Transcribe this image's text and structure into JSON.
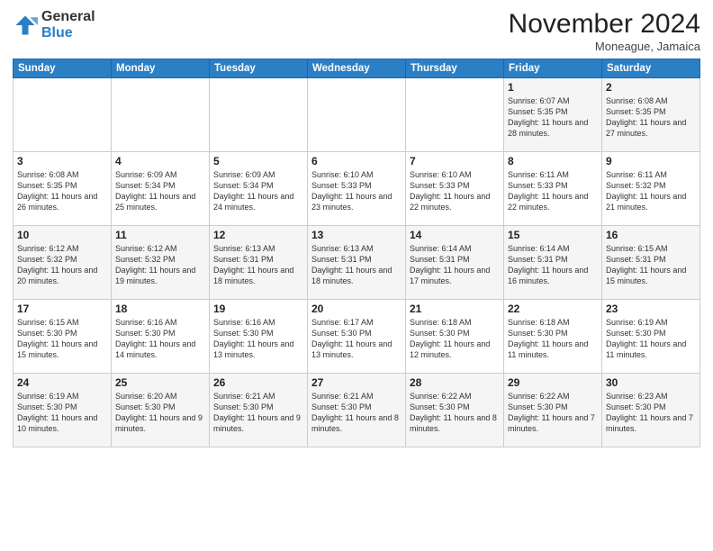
{
  "logo": {
    "general": "General",
    "blue": "Blue"
  },
  "header": {
    "month": "November 2024",
    "location": "Moneague, Jamaica"
  },
  "days_of_week": [
    "Sunday",
    "Monday",
    "Tuesday",
    "Wednesday",
    "Thursday",
    "Friday",
    "Saturday"
  ],
  "weeks": [
    [
      {
        "day": "",
        "sunrise": "",
        "sunset": "",
        "daylight": ""
      },
      {
        "day": "",
        "sunrise": "",
        "sunset": "",
        "daylight": ""
      },
      {
        "day": "",
        "sunrise": "",
        "sunset": "",
        "daylight": ""
      },
      {
        "day": "",
        "sunrise": "",
        "sunset": "",
        "daylight": ""
      },
      {
        "day": "",
        "sunrise": "",
        "sunset": "",
        "daylight": ""
      },
      {
        "day": "1",
        "sunrise": "Sunrise: 6:07 AM",
        "sunset": "Sunset: 5:35 PM",
        "daylight": "Daylight: 11 hours and 28 minutes."
      },
      {
        "day": "2",
        "sunrise": "Sunrise: 6:08 AM",
        "sunset": "Sunset: 5:35 PM",
        "daylight": "Daylight: 11 hours and 27 minutes."
      }
    ],
    [
      {
        "day": "3",
        "sunrise": "Sunrise: 6:08 AM",
        "sunset": "Sunset: 5:35 PM",
        "daylight": "Daylight: 11 hours and 26 minutes."
      },
      {
        "day": "4",
        "sunrise": "Sunrise: 6:09 AM",
        "sunset": "Sunset: 5:34 PM",
        "daylight": "Daylight: 11 hours and 25 minutes."
      },
      {
        "day": "5",
        "sunrise": "Sunrise: 6:09 AM",
        "sunset": "Sunset: 5:34 PM",
        "daylight": "Daylight: 11 hours and 24 minutes."
      },
      {
        "day": "6",
        "sunrise": "Sunrise: 6:10 AM",
        "sunset": "Sunset: 5:33 PM",
        "daylight": "Daylight: 11 hours and 23 minutes."
      },
      {
        "day": "7",
        "sunrise": "Sunrise: 6:10 AM",
        "sunset": "Sunset: 5:33 PM",
        "daylight": "Daylight: 11 hours and 22 minutes."
      },
      {
        "day": "8",
        "sunrise": "Sunrise: 6:11 AM",
        "sunset": "Sunset: 5:33 PM",
        "daylight": "Daylight: 11 hours and 22 minutes."
      },
      {
        "day": "9",
        "sunrise": "Sunrise: 6:11 AM",
        "sunset": "Sunset: 5:32 PM",
        "daylight": "Daylight: 11 hours and 21 minutes."
      }
    ],
    [
      {
        "day": "10",
        "sunrise": "Sunrise: 6:12 AM",
        "sunset": "Sunset: 5:32 PM",
        "daylight": "Daylight: 11 hours and 20 minutes."
      },
      {
        "day": "11",
        "sunrise": "Sunrise: 6:12 AM",
        "sunset": "Sunset: 5:32 PM",
        "daylight": "Daylight: 11 hours and 19 minutes."
      },
      {
        "day": "12",
        "sunrise": "Sunrise: 6:13 AM",
        "sunset": "Sunset: 5:31 PM",
        "daylight": "Daylight: 11 hours and 18 minutes."
      },
      {
        "day": "13",
        "sunrise": "Sunrise: 6:13 AM",
        "sunset": "Sunset: 5:31 PM",
        "daylight": "Daylight: 11 hours and 18 minutes."
      },
      {
        "day": "14",
        "sunrise": "Sunrise: 6:14 AM",
        "sunset": "Sunset: 5:31 PM",
        "daylight": "Daylight: 11 hours and 17 minutes."
      },
      {
        "day": "15",
        "sunrise": "Sunrise: 6:14 AM",
        "sunset": "Sunset: 5:31 PM",
        "daylight": "Daylight: 11 hours and 16 minutes."
      },
      {
        "day": "16",
        "sunrise": "Sunrise: 6:15 AM",
        "sunset": "Sunset: 5:31 PM",
        "daylight": "Daylight: 11 hours and 15 minutes."
      }
    ],
    [
      {
        "day": "17",
        "sunrise": "Sunrise: 6:15 AM",
        "sunset": "Sunset: 5:30 PM",
        "daylight": "Daylight: 11 hours and 15 minutes."
      },
      {
        "day": "18",
        "sunrise": "Sunrise: 6:16 AM",
        "sunset": "Sunset: 5:30 PM",
        "daylight": "Daylight: 11 hours and 14 minutes."
      },
      {
        "day": "19",
        "sunrise": "Sunrise: 6:16 AM",
        "sunset": "Sunset: 5:30 PM",
        "daylight": "Daylight: 11 hours and 13 minutes."
      },
      {
        "day": "20",
        "sunrise": "Sunrise: 6:17 AM",
        "sunset": "Sunset: 5:30 PM",
        "daylight": "Daylight: 11 hours and 13 minutes."
      },
      {
        "day": "21",
        "sunrise": "Sunrise: 6:18 AM",
        "sunset": "Sunset: 5:30 PM",
        "daylight": "Daylight: 11 hours and 12 minutes."
      },
      {
        "day": "22",
        "sunrise": "Sunrise: 6:18 AM",
        "sunset": "Sunset: 5:30 PM",
        "daylight": "Daylight: 11 hours and 11 minutes."
      },
      {
        "day": "23",
        "sunrise": "Sunrise: 6:19 AM",
        "sunset": "Sunset: 5:30 PM",
        "daylight": "Daylight: 11 hours and 11 minutes."
      }
    ],
    [
      {
        "day": "24",
        "sunrise": "Sunrise: 6:19 AM",
        "sunset": "Sunset: 5:30 PM",
        "daylight": "Daylight: 11 hours and 10 minutes."
      },
      {
        "day": "25",
        "sunrise": "Sunrise: 6:20 AM",
        "sunset": "Sunset: 5:30 PM",
        "daylight": "Daylight: 11 hours and 9 minutes."
      },
      {
        "day": "26",
        "sunrise": "Sunrise: 6:21 AM",
        "sunset": "Sunset: 5:30 PM",
        "daylight": "Daylight: 11 hours and 9 minutes."
      },
      {
        "day": "27",
        "sunrise": "Sunrise: 6:21 AM",
        "sunset": "Sunset: 5:30 PM",
        "daylight": "Daylight: 11 hours and 8 minutes."
      },
      {
        "day": "28",
        "sunrise": "Sunrise: 6:22 AM",
        "sunset": "Sunset: 5:30 PM",
        "daylight": "Daylight: 11 hours and 8 minutes."
      },
      {
        "day": "29",
        "sunrise": "Sunrise: 6:22 AM",
        "sunset": "Sunset: 5:30 PM",
        "daylight": "Daylight: 11 hours and 7 minutes."
      },
      {
        "day": "30",
        "sunrise": "Sunrise: 6:23 AM",
        "sunset": "Sunset: 5:30 PM",
        "daylight": "Daylight: 11 hours and 7 minutes."
      }
    ]
  ]
}
